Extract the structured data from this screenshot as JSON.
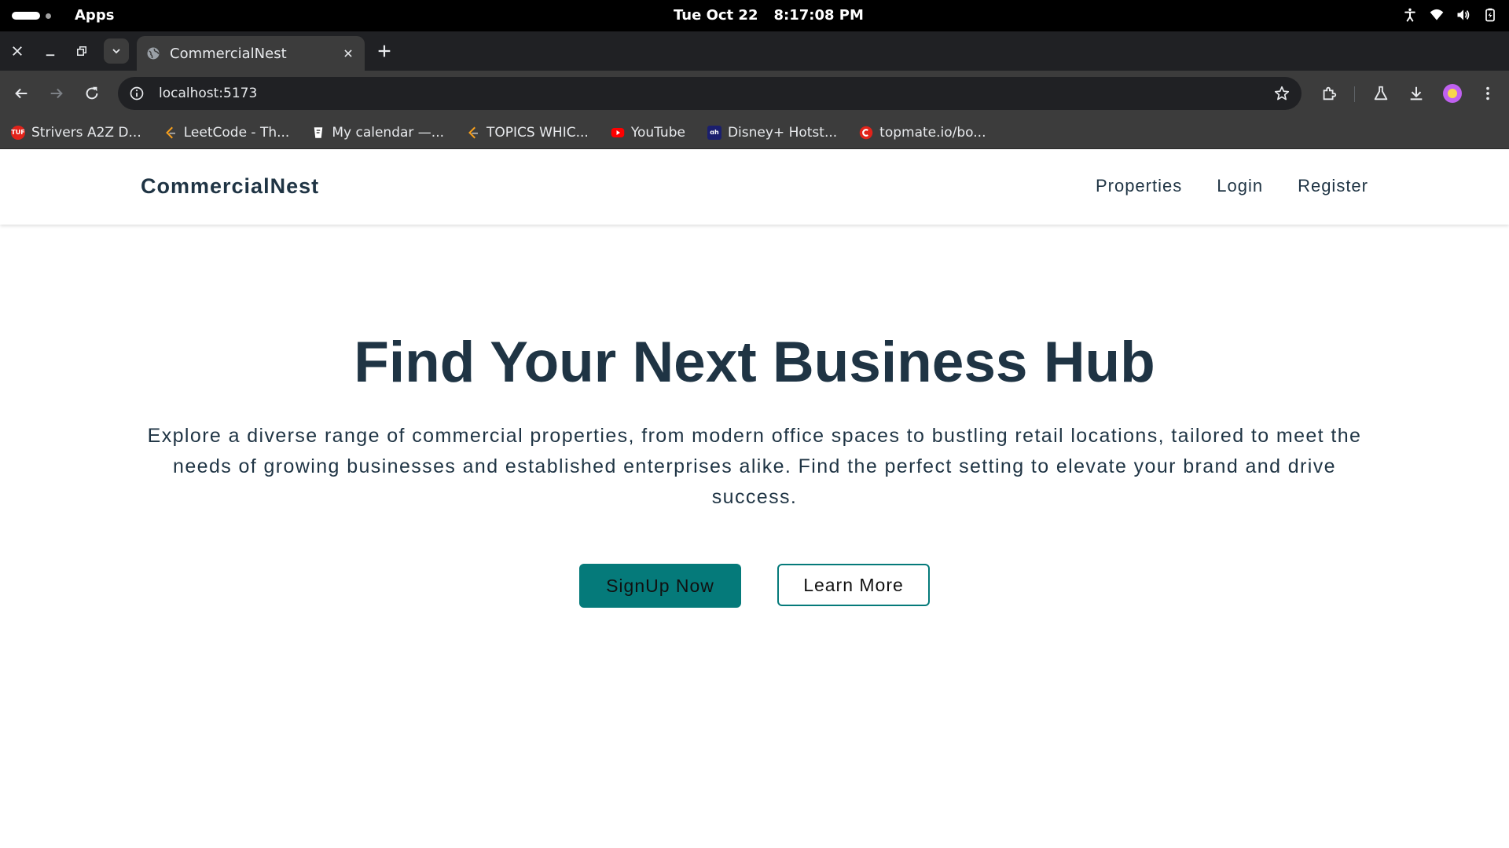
{
  "os": {
    "apps_label": "Apps",
    "date": "Tue Oct 22",
    "time": "8:17:08 PM",
    "tray_icons": [
      "accessibility-icon",
      "wifi-icon",
      "volume-icon",
      "battery-icon"
    ]
  },
  "browser": {
    "tab_title": "CommercialNest",
    "url": "localhost:5173",
    "bookmarks": [
      {
        "label": "Strivers A2Z D...",
        "icon": "tuf-icon",
        "color": "#e2231a",
        "badge": "TUF"
      },
      {
        "label": "LeetCode - Th...",
        "icon": "leetcode-icon",
        "color": "#f89f1b",
        "badge": ""
      },
      {
        "label": "My calendar —...",
        "icon": "calendar-icon",
        "color": "#ffffff",
        "badge": ""
      },
      {
        "label": "TOPICS WHIC...",
        "icon": "leetcode-icon",
        "color": "#f89f1b",
        "badge": ""
      },
      {
        "label": "YouTube",
        "icon": "youtube-icon",
        "color": "#ff0000",
        "badge": ""
      },
      {
        "label": "Disney+ Hotst...",
        "icon": "hotstar-icon",
        "color": "#1b1f6e",
        "badge": "ɑh"
      },
      {
        "label": "topmate.io/bo...",
        "icon": "topmate-icon",
        "color": "#e2231a",
        "badge": ""
      }
    ]
  },
  "site": {
    "brand": "CommercialNest",
    "nav": {
      "properties": "Properties",
      "login": "Login",
      "register": "Register"
    },
    "hero": {
      "title": "Find Your Next Business Hub",
      "description": "Explore a diverse range of commercial properties, from modern office spaces to bustling retail locations, tailored to meet the needs of growing businesses and established enterprises alike. Find the perfect setting to elevate your brand and drive success.",
      "primary_cta": "SignUp Now",
      "secondary_cta": "Learn More"
    }
  },
  "colors": {
    "accent": "#057a7a",
    "heading": "#1f3444"
  }
}
